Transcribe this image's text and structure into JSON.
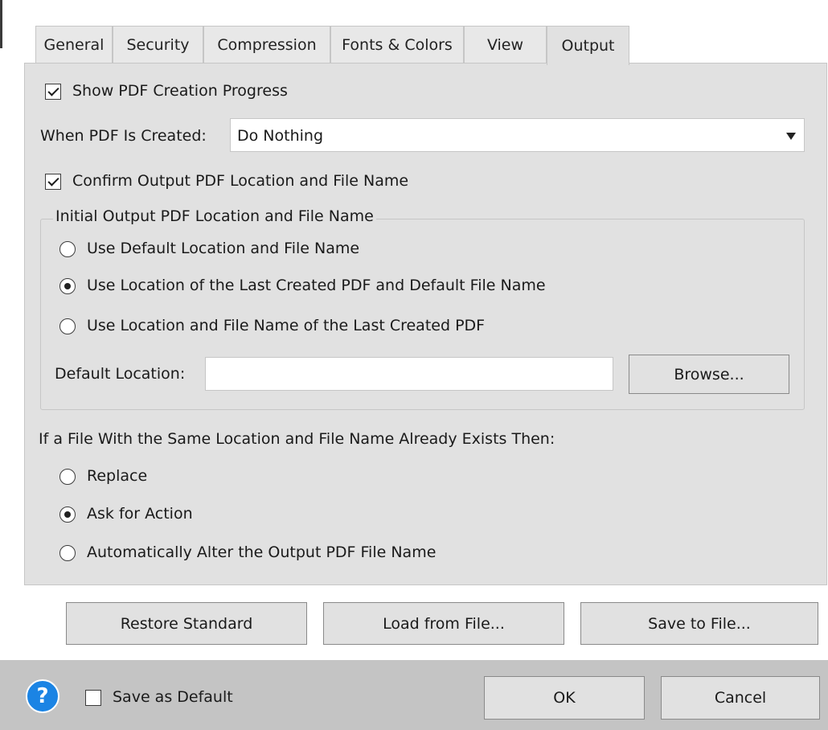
{
  "tabs": [
    {
      "label": "General"
    },
    {
      "label": "Security"
    },
    {
      "label": "Compression"
    },
    {
      "label": "Fonts & Colors"
    },
    {
      "label": "View"
    },
    {
      "label": "Output",
      "active": true
    }
  ],
  "show_progress": {
    "label": "Show PDF Creation Progress",
    "checked": true
  },
  "when_created": {
    "label": "When PDF Is Created:",
    "value": "Do Nothing"
  },
  "confirm_output": {
    "label": "Confirm Output PDF Location and File Name",
    "checked": true
  },
  "initial_group": {
    "title": "Initial Output PDF Location and File Name",
    "options": [
      {
        "label": "Use Default Location and File Name",
        "selected": false
      },
      {
        "label": "Use Location of the Last Created PDF and Default File Name",
        "selected": true
      },
      {
        "label": "Use Location and File Name of the Last Created PDF",
        "selected": false
      }
    ],
    "default_location_label": "Default Location:",
    "default_location_value": "",
    "browse_label": "Browse..."
  },
  "exists": {
    "title": "If a File With the Same Location and File Name Already Exists Then:",
    "options": [
      {
        "label": "Replace",
        "selected": false
      },
      {
        "label": "Ask for Action",
        "selected": true
      },
      {
        "label": "Automatically Alter the Output PDF File Name",
        "selected": false
      }
    ]
  },
  "actions": {
    "restore": "Restore Standard",
    "load": "Load from File...",
    "save": "Save to File..."
  },
  "footer": {
    "help_glyph": "?",
    "save_default_label": "Save as Default",
    "save_default_checked": false,
    "ok": "OK",
    "cancel": "Cancel"
  },
  "colors": {
    "panel": "#e1e1e1",
    "footer": "#c4c4c4",
    "help": "#1b84e4"
  }
}
